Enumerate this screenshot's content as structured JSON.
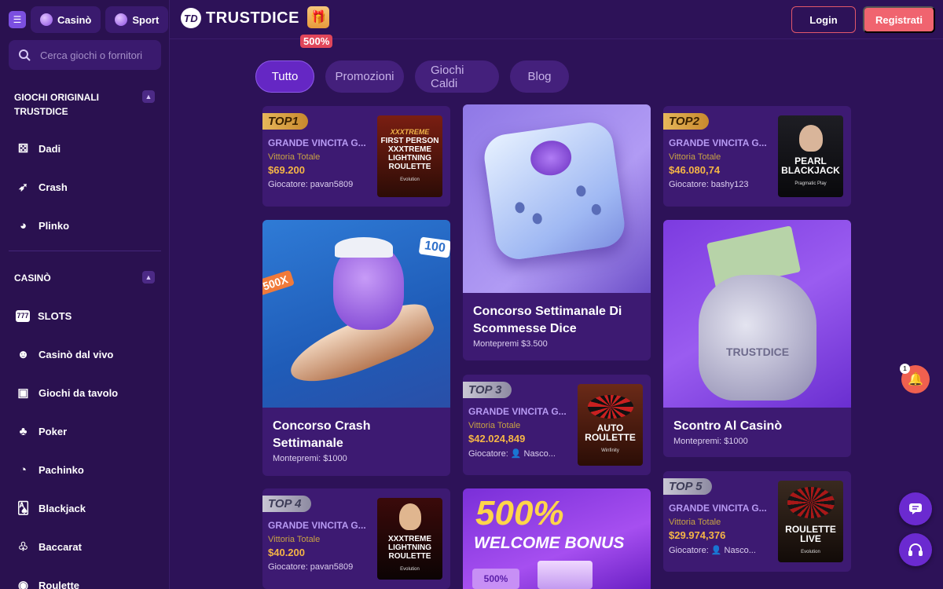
{
  "sidebar": {
    "casino_tab": "Casinò",
    "sport_tab": "Sport",
    "search_placeholder": "Cerca giochi o fornitori",
    "originals_heading": "GIOCHI ORIGINALI TRUSTDICE",
    "originals": [
      "Dadi",
      "Crash",
      "Plinko"
    ],
    "casino_heading": "CASINÒ",
    "casino_items": [
      "SLOTS",
      "Casinò dal vivo",
      "Giochi da tavolo",
      "Poker",
      "Pachinko",
      "Blackjack",
      "Baccarat",
      "Roulette"
    ]
  },
  "header": {
    "logo": "TRUSTDICE",
    "bonus_badge": "500%",
    "login": "Login",
    "register": "Registrati"
  },
  "tabs": [
    "Tutto",
    "Promozioni",
    "Giochi Caldi",
    "Blog"
  ],
  "wins": [
    {
      "rank": "TOP1",
      "title": "GRANDE VINCITA G...",
      "sub": "Vittoria Totale",
      "amount": "$69.200",
      "player": "Giocatore: pavan5809",
      "thumb_brand": "XXXTREME",
      "thumb_title": "FIRST PERSON XXXTREME LIGHTNING ROULETTE",
      "thumb_provider": "Evolution"
    },
    {
      "rank": "TOP2",
      "title": "GRANDE VINCITA G...",
      "sub": "Vittoria Totale",
      "amount": "$46.080,74",
      "player": "Giocatore: bashy123",
      "thumb_title": "PEARL BLACKJACK",
      "thumb_provider": "Pragmatic Play"
    },
    {
      "rank": "TOP 3",
      "title": "GRANDE VINCITA G...",
      "sub": "Vittoria Totale",
      "amount": "$42.024,849",
      "player": "Giocatore: 👤 Nasco...",
      "thumb_title": "AUTO ROULETTE",
      "thumb_provider": "Winfinity"
    },
    {
      "rank": "TOP 4",
      "title": "GRANDE VINCITA G...",
      "sub": "Vittoria Totale",
      "amount": "$40.200",
      "player": "Giocatore: pavan5809",
      "thumb_title": "XXXTREME LIGHTNING ROULETTE",
      "thumb_provider": "Evolution"
    },
    {
      "rank": "TOP 5",
      "title": "GRANDE VINCITA G...",
      "sub": "Vittoria Totale",
      "amount": "$29.974,376",
      "player": "Giocatore: 👤 Nasco...",
      "thumb_title": "ROULETTE LIVE",
      "thumb_provider": "Evolution"
    }
  ],
  "promos": {
    "crash": {
      "title": "Concorso Crash Settimanale",
      "sub": "Montepremi: $1000",
      "badges": [
        "100",
        "500X"
      ]
    },
    "dice": {
      "title": "Concorso Settimanale Di Scommesse Dice",
      "sub": "Montepremi $3.500"
    },
    "casino": {
      "title": "Scontro Al Casinò",
      "sub": "Montepremi: $1000",
      "bag_label": "TRUSTDICE"
    },
    "welcome": {
      "big": "500%",
      "text": "WELCOME BONUS",
      "ticket": "500%"
    }
  },
  "notifications": {
    "count": "1"
  }
}
